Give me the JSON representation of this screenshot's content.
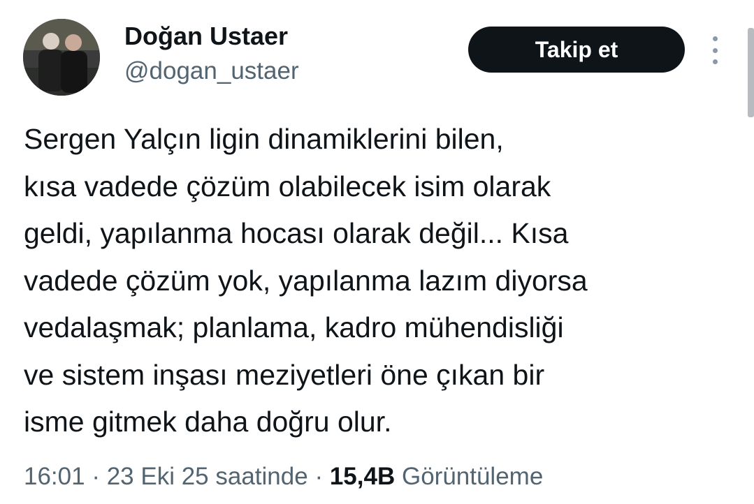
{
  "author": {
    "display_name": "Doğan Ustaer",
    "handle": "@dogan_ustaer"
  },
  "actions": {
    "follow_label": "Takip et",
    "more_icon": "more-vertical-icon"
  },
  "tweet": {
    "lines": [
      "Sergen Yalçın ligin dinamiklerini bilen,",
      "kısa vadede çözüm olabilecek isim olarak",
      "geldi, yapılanma hocası olarak değil... Kısa",
      "vadede çözüm yok, yapılanma lazım diyorsa",
      "vedalaşmak; planlama, kadro mühendisliği",
      "ve sistem inşası meziyetleri öne çıkan bir",
      "isme gitmek daha doğru olur."
    ]
  },
  "meta": {
    "time": "16:01",
    "separator": "·",
    "date": "23 Eki 25 saatinde",
    "views_count": "15,4B",
    "views_label": "Görüntüleme"
  },
  "colors": {
    "text_primary": "#0f1419",
    "text_secondary": "#536471",
    "button_bg": "#0f1419",
    "button_text": "#ffffff"
  }
}
